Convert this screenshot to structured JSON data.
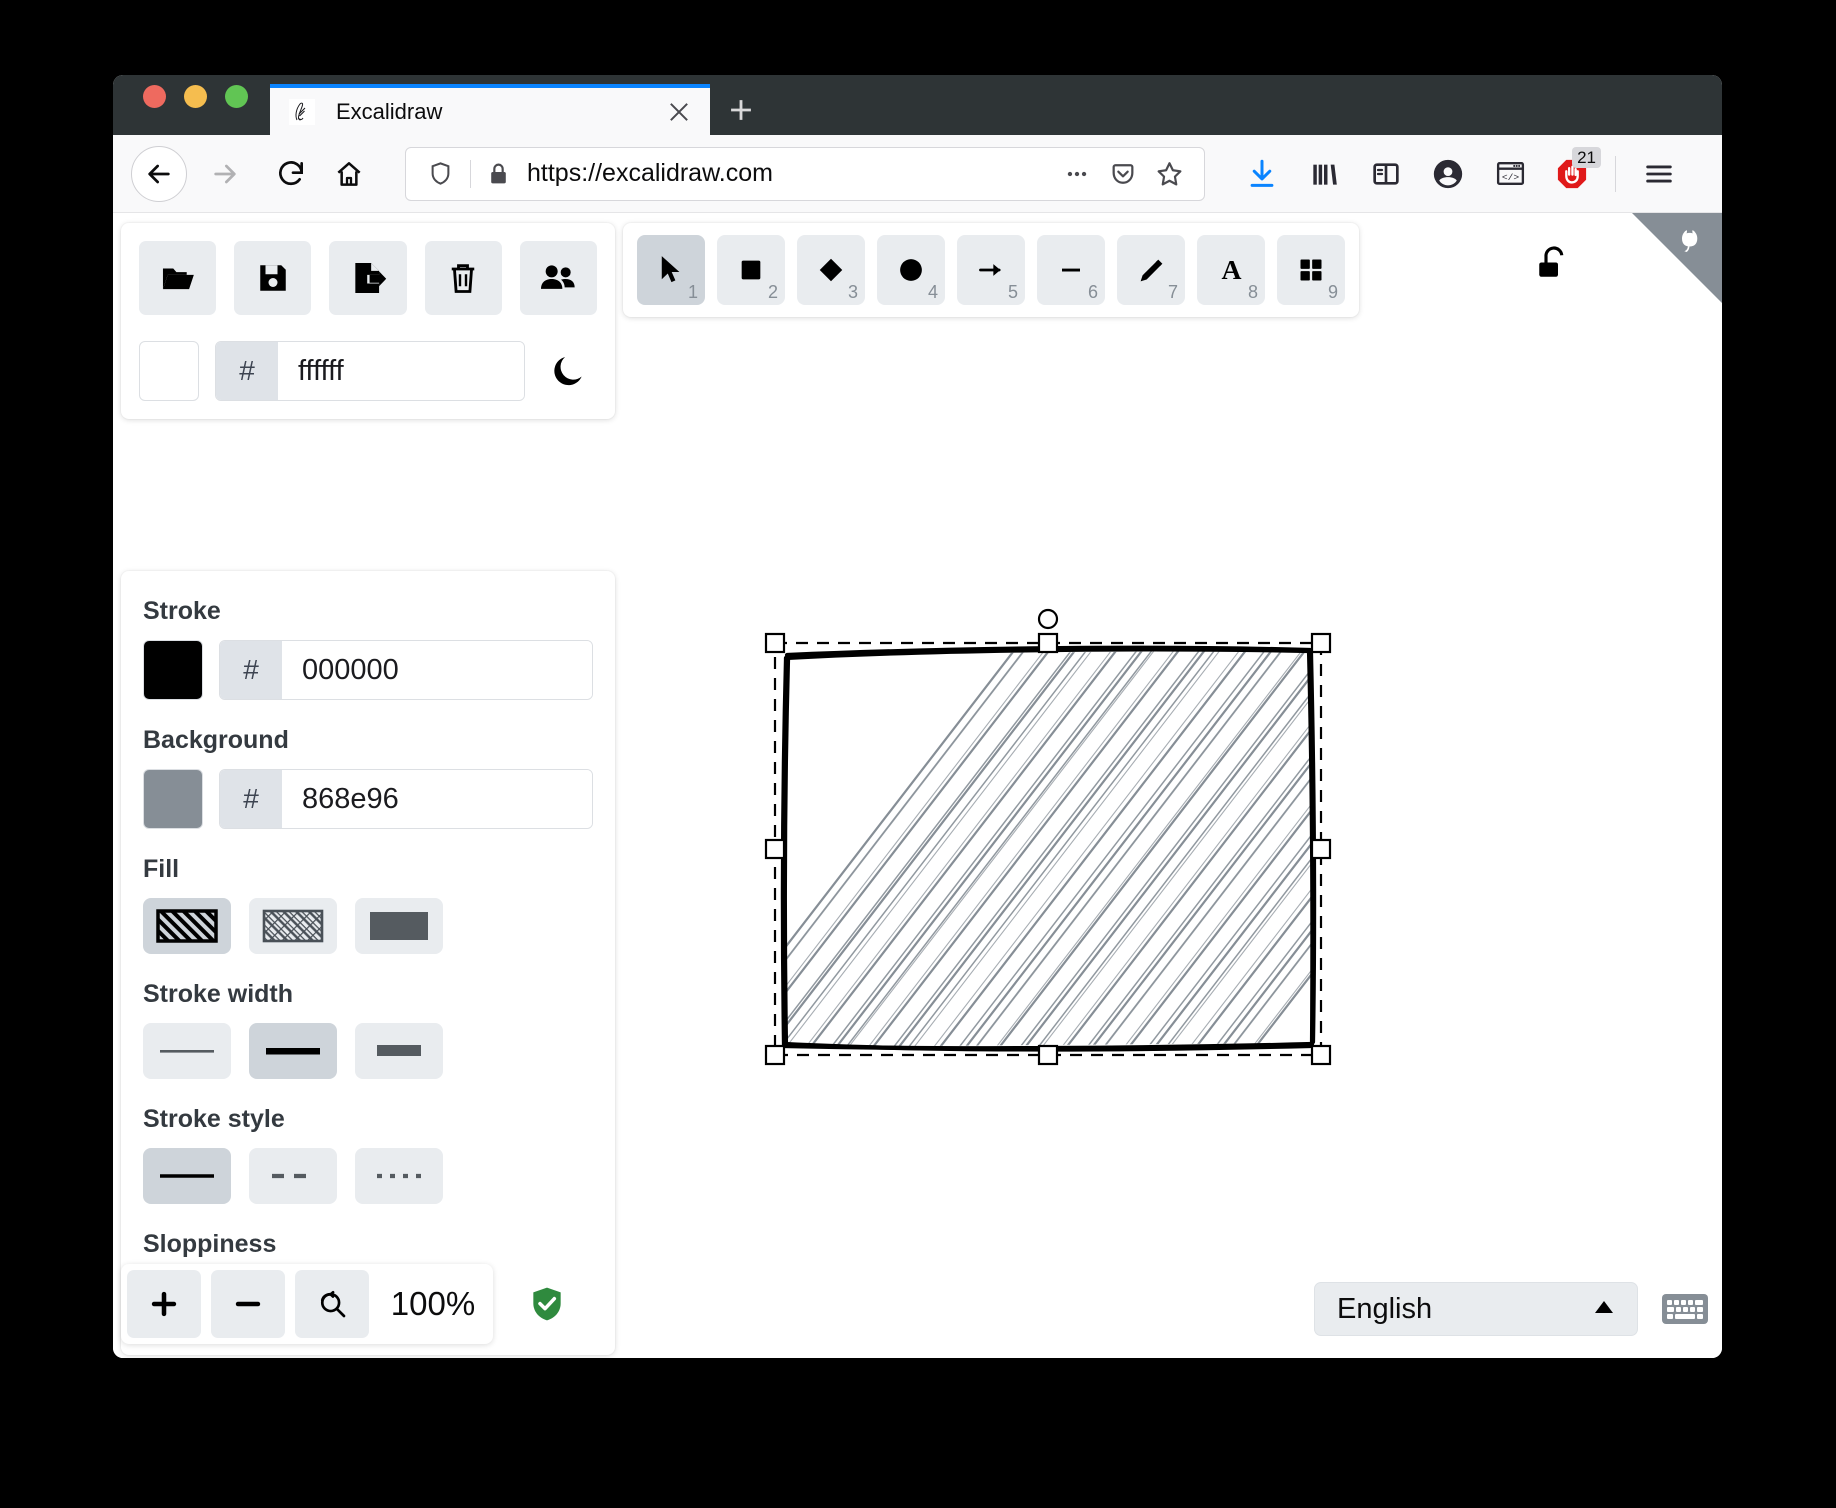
{
  "browser": {
    "tab": {
      "title": "Excalidraw",
      "favicon_icon": "excalidraw-favicon",
      "close_icon": "close-icon"
    },
    "new_tab_icon": "plus-icon",
    "nav": {
      "back_icon": "back-arrow-icon",
      "forward_icon": "forward-arrow-icon",
      "reload_icon": "reload-icon",
      "home_icon": "home-icon"
    },
    "url": {
      "value": "https://excalidraw.com",
      "shield_icon": "tracking-shield-icon",
      "lock_icon": "padlock-icon",
      "more_icon": "ellipsis-icon",
      "pocket_icon": "pocket-icon",
      "bookmark_icon": "star-icon"
    },
    "toolbar": [
      {
        "name": "downloads-button",
        "icon": "download-arrow-icon",
        "badge": ""
      },
      {
        "name": "library-button",
        "icon": "library-icon",
        "badge": ""
      },
      {
        "name": "sidebar-button",
        "icon": "sidebar-icon",
        "badge": ""
      },
      {
        "name": "account-button",
        "icon": "account-circle-icon",
        "badge": ""
      },
      {
        "name": "devtools-button",
        "icon": "code-window-icon",
        "badge": ""
      },
      {
        "name": "adblock-button",
        "icon": "adblock-stop-hand-icon",
        "badge": "21"
      }
    ],
    "menu_icon": "hamburger-menu-icon"
  },
  "app": {
    "github_corner_icon": "github-cat-corner-icon",
    "file_actions": [
      {
        "name": "load-file-button",
        "icon": "folder-open-icon"
      },
      {
        "name": "save-file-button",
        "icon": "floppy-disk-icon"
      },
      {
        "name": "export-button",
        "icon": "export-file-icon"
      },
      {
        "name": "reset-canvas-button",
        "icon": "trash-icon"
      },
      {
        "name": "live-collaboration-button",
        "icon": "people-icon"
      }
    ],
    "canvas_background": {
      "swatch_color": "#ffffff",
      "hash": "#",
      "value": "ffffff",
      "theme_toggle_icon": "moon-icon"
    },
    "tools": [
      {
        "name": "selection-tool",
        "icon": "cursor-arrow-icon",
        "shortcut": "1",
        "active": true
      },
      {
        "name": "rectangle-tool",
        "icon": "square-icon",
        "shortcut": "2",
        "active": false
      },
      {
        "name": "diamond-tool",
        "icon": "diamond-icon",
        "shortcut": "3",
        "active": false
      },
      {
        "name": "ellipse-tool",
        "icon": "circle-icon",
        "shortcut": "4",
        "active": false
      },
      {
        "name": "arrow-tool",
        "icon": "arrow-right-icon",
        "shortcut": "5",
        "active": false
      },
      {
        "name": "line-tool",
        "icon": "line-icon",
        "shortcut": "6",
        "active": false
      },
      {
        "name": "draw-tool",
        "icon": "pencil-icon",
        "shortcut": "7",
        "active": false
      },
      {
        "name": "text-tool",
        "icon": "letter-a-icon",
        "shortcut": "8",
        "active": false
      },
      {
        "name": "library-tool",
        "icon": "grid-squares-icon",
        "shortcut": "9",
        "active": false
      }
    ],
    "lock_tool": {
      "name": "keep-tool-active-lock",
      "icon": "unlocked-padlock-icon"
    },
    "properties": {
      "stroke": {
        "label": "Stroke",
        "swatch_color": "#000000",
        "hash": "#",
        "value": "000000"
      },
      "background": {
        "label": "Background",
        "swatch_color": "#868e96",
        "hash": "#",
        "value": "868e96"
      },
      "fill": {
        "label": "Fill",
        "options": [
          {
            "name": "fill-hachure",
            "icon": "hachure-fill-icon",
            "active": true
          },
          {
            "name": "fill-cross-hatch",
            "icon": "cross-hatch-fill-icon",
            "active": false
          },
          {
            "name": "fill-solid",
            "icon": "solid-fill-icon",
            "active": false
          }
        ]
      },
      "stroke_width": {
        "label": "Stroke width",
        "options": [
          {
            "name": "stroke-width-thin",
            "icon": "thin-line-icon",
            "active": false
          },
          {
            "name": "stroke-width-bold",
            "icon": "bold-line-icon",
            "active": true
          },
          {
            "name": "stroke-width-extra-bold",
            "icon": "extra-bold-line-icon",
            "active": false
          }
        ]
      },
      "stroke_style": {
        "label": "Stroke style",
        "options": [
          {
            "name": "stroke-style-solid",
            "icon": "solid-line-icon",
            "active": true
          },
          {
            "name": "stroke-style-dashed",
            "icon": "dashed-line-icon",
            "active": false
          },
          {
            "name": "stroke-style-dotted",
            "icon": "dotted-line-icon",
            "active": false
          }
        ]
      },
      "sloppiness": {
        "label": "Sloppiness",
        "options": [
          {
            "name": "sloppiness-architect",
            "icon": "architect-scribble-icon",
            "active": false
          },
          {
            "name": "sloppiness-artist",
            "icon": "artist-scribble-icon",
            "active": false
          },
          {
            "name": "sloppiness-cartoonist",
            "icon": "cartoonist-scribble-icon",
            "active": true
          }
        ]
      }
    },
    "footer": {
      "zoom_in": {
        "name": "zoom-in-button",
        "icon": "plus-icon"
      },
      "zoom_out": {
        "name": "zoom-out-button",
        "icon": "minus-icon"
      },
      "zoom_reset": {
        "name": "zoom-reset-button",
        "icon": "magnifier-reset-icon"
      },
      "zoom_value": "100%",
      "encryption_badge_icon": "green-shield-check-icon",
      "language": {
        "value": "English",
        "chevron_icon": "chevron-up-icon"
      },
      "shortcuts_icon": "keyboard-icon"
    },
    "selected_shape": {
      "type": "rectangle",
      "fill_style": "hachure",
      "stroke_color": "#000000",
      "background_color": "#868e96",
      "handles": [
        "top-left",
        "top-center",
        "top-right",
        "middle-left",
        "middle-right",
        "bottom-left",
        "bottom-center",
        "bottom-right",
        "rotate"
      ]
    }
  }
}
